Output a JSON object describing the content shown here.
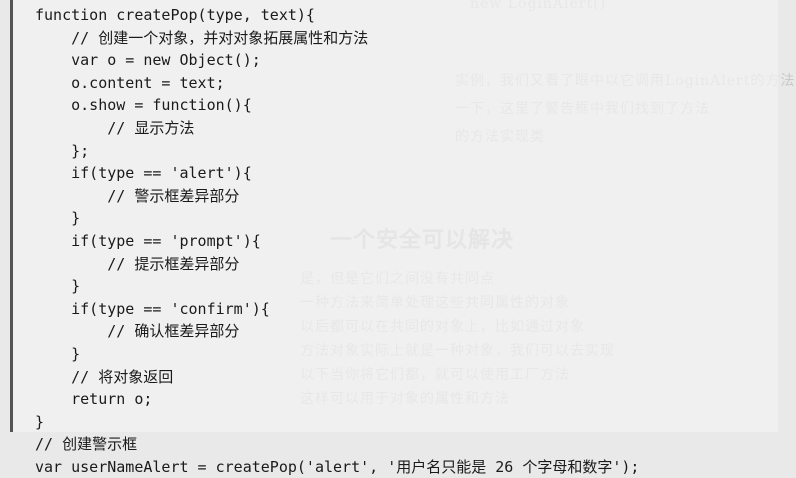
{
  "code": {
    "lines": [
      "function createPop(type, text){",
      "    // 创建一个对象，并对对象拓展属性和方法",
      "    var o = new Object();",
      "    o.content = text;",
      "    o.show = function(){",
      "        // 显示方法",
      "    };",
      "    if(type == 'alert'){",
      "        // 警示框差异部分",
      "    }",
      "    if(type == 'prompt'){",
      "        // 提示框差异部分",
      "    }",
      "    if(type == 'confirm'){",
      "        // 确认框差异部分",
      "    }",
      "    // 将对象返回",
      "    return o;",
      "}",
      "// 创建警示框",
      "var userNameAlert = createPop('alert', '用户名只能是 26 个字母和数字');"
    ]
  }
}
